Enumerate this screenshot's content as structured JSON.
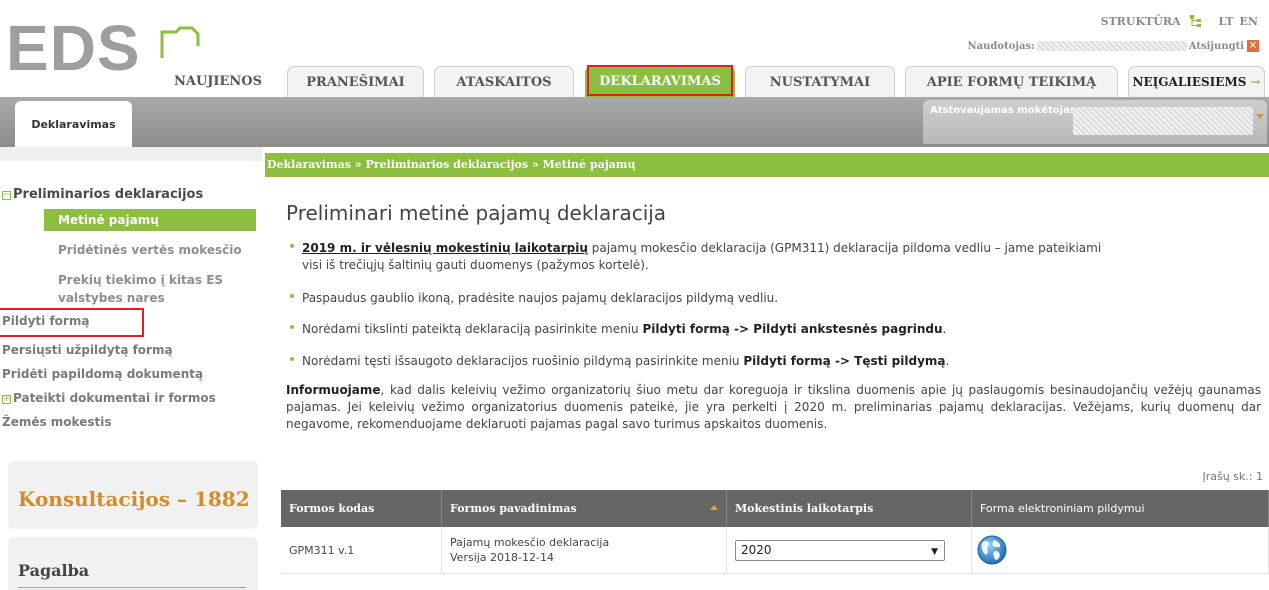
{
  "header": {
    "logo": "EDS",
    "structure_link": "STRUKTŪRA",
    "lang_lt": "LT",
    "lang_en": "EN",
    "user_label": "Naudotojas:",
    "logout": "Atsijungti",
    "tabs": [
      {
        "label": "NAUJIENOS"
      },
      {
        "label": "PRANEŠIMAI"
      },
      {
        "label": "ATASKAITOS"
      },
      {
        "label": "DEKLARAVIMAS",
        "active": true
      },
      {
        "label": "NUSTATYMAI"
      },
      {
        "label": "APIE FORMŲ TEIKIMĄ"
      },
      {
        "label": "NEĮGALIESIEMS",
        "arrow": "→"
      }
    ]
  },
  "subbar": {
    "tab": "Deklaravimas",
    "taxpayer_label": "Atstovaujamas mokėtojas:"
  },
  "sidebar": {
    "root": "Preliminarios deklaracijos",
    "active": "Metinė pajamų",
    "children": [
      "Pridėtinės vertės mokesčio",
      "Prekių tiekimo į kitas ES",
      "valstybes nares"
    ],
    "items": [
      "Pildyti formą",
      "Persiųsti užpildytą formą",
      "Pridėti papildomą dokumentą",
      "Pateikti dokumentai ir formos",
      "Žemės mokestis"
    ],
    "konsultacijos": "Konsultacijos – 1882",
    "pagalba": "Pagalba"
  },
  "main": {
    "breadcrumb": "Deklaravimas » Preliminarios deklaracijos » Metinė pajamų",
    "title": "Preliminari metinė pajamų deklaracija",
    "bullet1_link": "2019 m. ir vėlesnių mokestinių laikotarpių",
    "bullet1_rest": " pajamų mokesčio deklaracija (GPM311) deklaracija pildoma vedliu – jame pateikiami",
    "bullet1_line2": "visi iš trečiųjų šaltinių gauti duomenys (pažymos kortelė).",
    "bullet2": "Paspaudus gaublio ikoną, pradėsite naujos pajamų deklaracijos pildymą vedliu.",
    "bullet3_pre": "Norėdami tikslinti pateiktą deklaraciją pasirinkite meniu ",
    "bullet3_bold": "Pildyti formą -> Pildyti ankstesnės pagrindu",
    "bullet3_post": ".",
    "bullet4_pre": "Norėdami tęsti išsaugoto deklaracijos ruošinio pildymą pasirinkite meniu ",
    "bullet4_bold": "Pildyti formą -> Tęsti pildymą",
    "bullet4_post": ".",
    "info_bold": "Informuojame",
    "info_text": ", kad dalis keleivių vežimo organizatorių šiuo metu dar koreguoja ir tikslina duomenis apie jų paslaugomis besinaudojančių vežėjų gaunamas pajamas. Jei keleivių vežimo organizatorius duomenis pateikė, jie yra perkelti į 2020 m. preliminarias pajamų deklaracijas. Vežėjams, kurių duomenų dar negavome, rekomenduojame deklaruoti pajamas pagal savo turimus apskaitos duomenis.",
    "record_count": "Įrašų sk.: 1"
  },
  "table": {
    "headers": [
      "Formos kodas",
      "Formos pavadinimas",
      "Mokestinis laikotarpis",
      "Forma elektroniniam pildymui"
    ],
    "rows": [
      {
        "code": "GPM311 v.1",
        "name": "Pajamų mokesčio deklaracija",
        "version": "Versija 2018-12-14",
        "period": "2020"
      }
    ]
  },
  "colors": {
    "accent_green": "#8cbf3f",
    "highlight_red": "#e21f26",
    "orange": "#d28d2a"
  },
  "icons": [
    "logo-folder-icon",
    "structure-tree-icon",
    "logout-x-icon",
    "sort-arrow-icon",
    "dropdown-arrow-icon",
    "globe-icon"
  ]
}
